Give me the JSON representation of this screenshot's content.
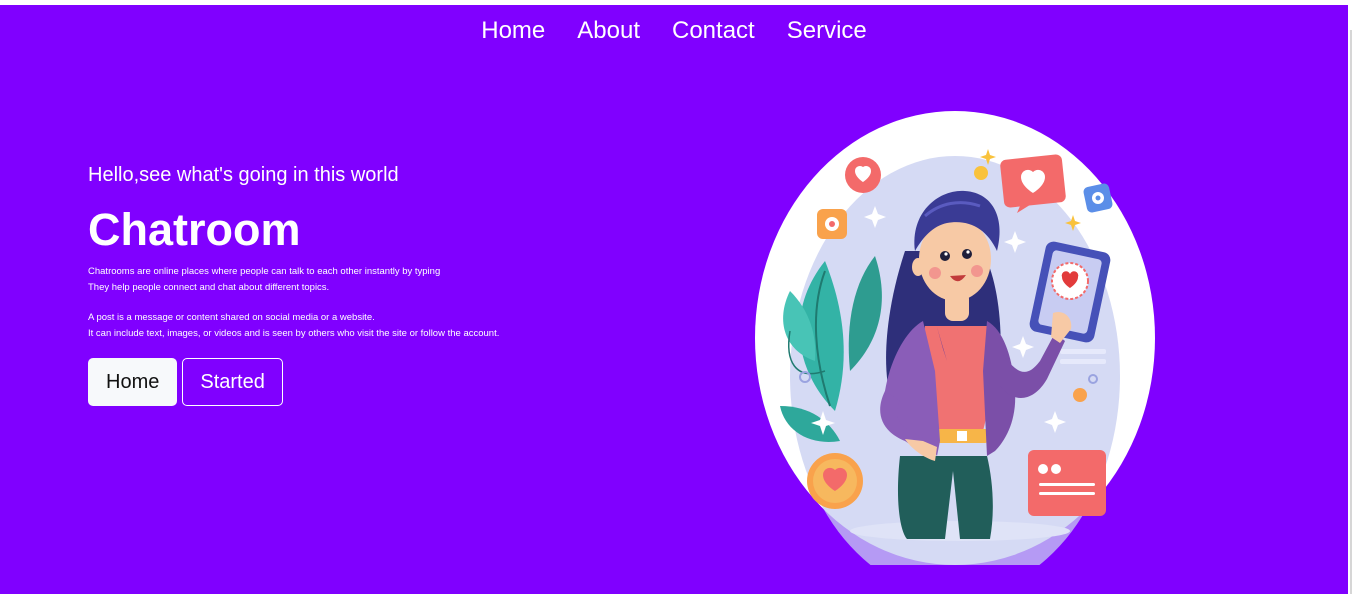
{
  "nav": {
    "items": [
      {
        "label": "Home"
      },
      {
        "label": "About"
      },
      {
        "label": "Contact"
      },
      {
        "label": "Service"
      }
    ]
  },
  "hero": {
    "greeting": "Hello,see what's going in this world",
    "title": "Chatroom",
    "description_p1": "Chatrooms are online places where people can talk to each other instantly by typing\nThey help people connect and chat about different topics.",
    "description_p2": "A post is a message or content shared on social media or a website.\nIt can include text, images, or videos and is seen by others who visit the site or follow the account.",
    "buttons": {
      "primary_label": "Home",
      "secondary_label": "Started"
    }
  },
  "illustration": {
    "icon": "woman-with-phone-social-media-illustration"
  },
  "colors": {
    "background": "#8000ff",
    "text": "#ffffff",
    "button_primary_bg": "#f7f9fb",
    "accent_pink": "#f26b6b",
    "accent_purple": "#7b4fa8"
  }
}
